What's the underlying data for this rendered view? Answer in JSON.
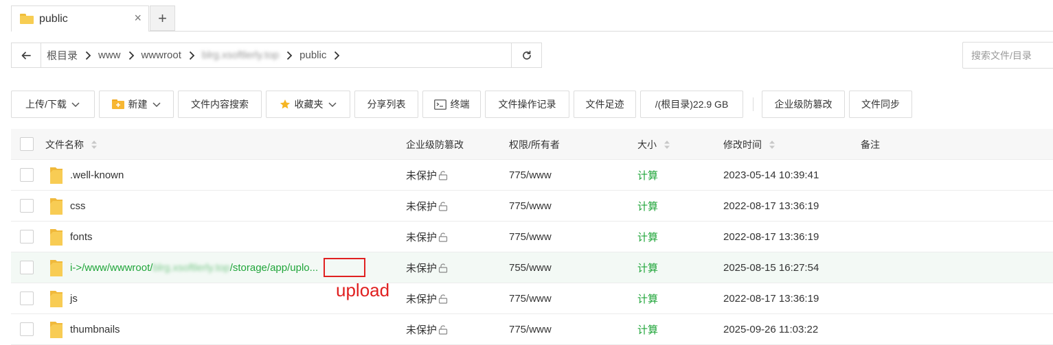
{
  "tab": {
    "title": "public",
    "close": "×",
    "add": "+"
  },
  "breadcrumbs": [
    {
      "label": "根目录"
    },
    {
      "label": "www"
    },
    {
      "label": "wwwroot"
    },
    {
      "label": "blrg.xsoftlerly.top",
      "blurred": true
    },
    {
      "label": "public"
    }
  ],
  "search": {
    "placeholder": "搜索文件/目录"
  },
  "toolbar": {
    "upload_label": "上传/下载",
    "new_label": "新建",
    "content_search_label": "文件内容搜索",
    "favorites_label": "收藏夹",
    "share_list_label": "分享列表",
    "terminal_label": "终端",
    "op_log_label": "文件操作记录",
    "footprint_label": "文件足迹",
    "disk_label": "/(根目录)22.9 GB",
    "tamper_label": "企业级防篡改",
    "sync_label": "文件同步"
  },
  "table": {
    "headers": {
      "name": "文件名称",
      "tamper": "企业级防篡改",
      "perm": "权限/所有者",
      "size": "大小",
      "mtime": "修改时间",
      "note": "备注"
    },
    "rows": [
      {
        "name": ".well-known",
        "tamper": "未保护",
        "perm": "775/www",
        "size": "计算",
        "mtime": "2023-05-14 10:39:41"
      },
      {
        "name": "css",
        "tamper": "未保护",
        "perm": "775/www",
        "size": "计算",
        "mtime": "2022-08-17 13:36:19"
      },
      {
        "name": "fonts",
        "tamper": "未保护",
        "perm": "775/www",
        "size": "计算",
        "mtime": "2022-08-17 13:36:19"
      },
      {
        "name_prefix": "i->/www/wwwroot/",
        "name_blurred": "blrg.xsoftlerly.top",
        "name_suffix": "/storage/app/",
        "name_tail": "uplo...",
        "tamper": "未保护",
        "perm": "755/www",
        "size": "计算",
        "mtime": "2025-08-15 16:27:54"
      },
      {
        "name": "js",
        "tamper": "未保护",
        "perm": "775/www",
        "size": "计算",
        "mtime": "2022-08-17 13:36:19"
      },
      {
        "name": "thumbnails",
        "tamper": "未保护",
        "perm": "775/www",
        "size": "计算",
        "mtime": "2025-09-26 11:03:22"
      }
    ]
  },
  "annotation": {
    "text": "upload",
    "color": "#e02020"
  },
  "colors": {
    "accent_green": "#20a53a",
    "folder_yellow": "#f7cd52",
    "annotation_red": "#e02020"
  }
}
